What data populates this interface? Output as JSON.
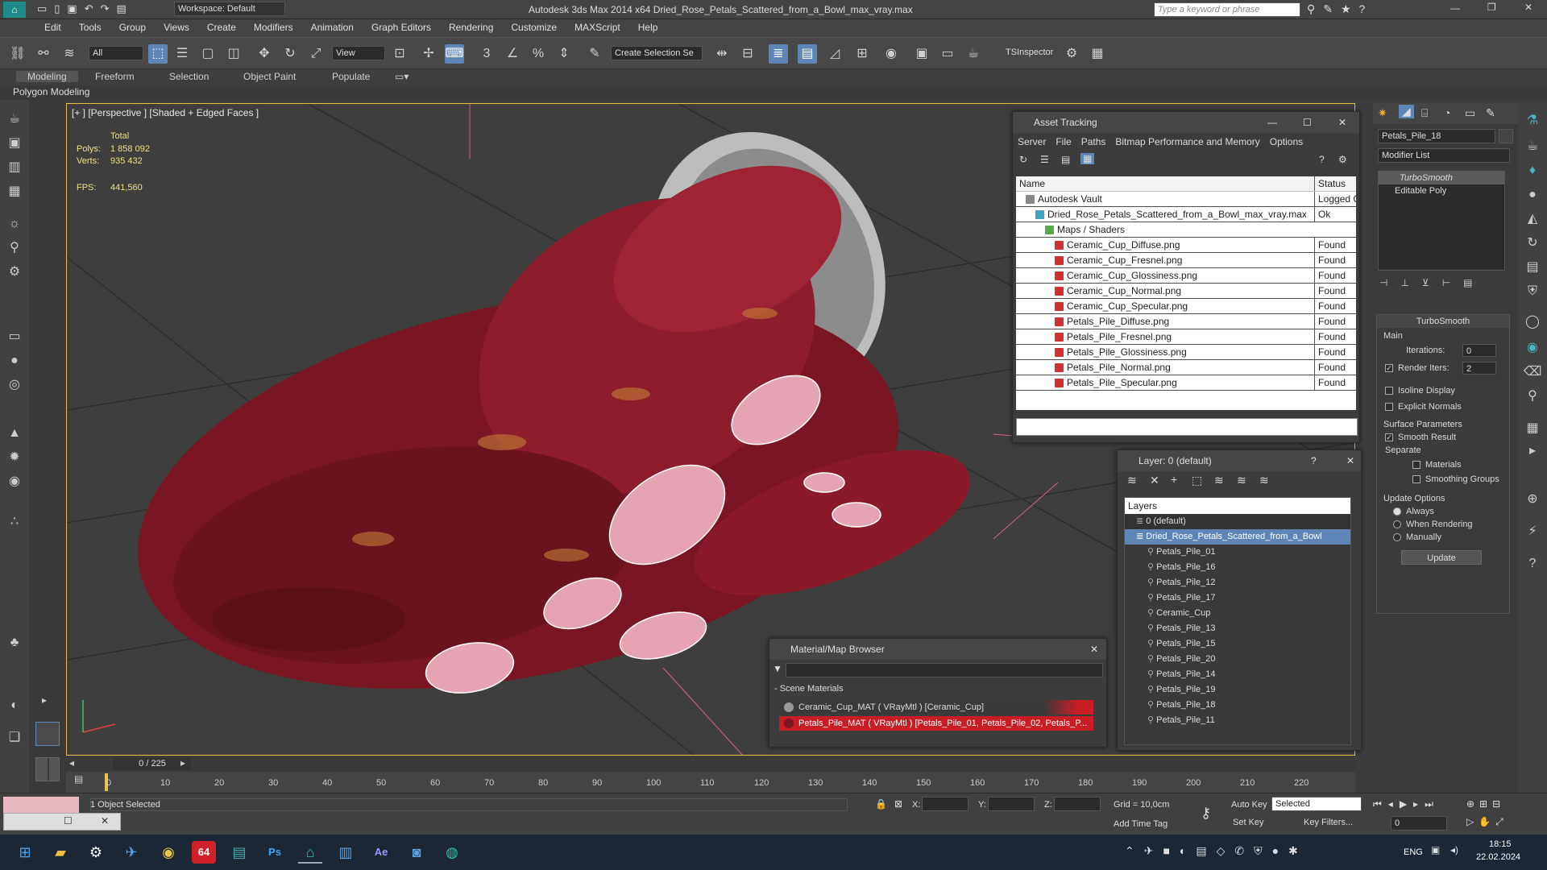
{
  "app": {
    "title": "Autodesk 3ds Max  2014 x64    Dried_Rose_Petals_Scattered_from_a_Bowl_max_vray.max",
    "workspace": "Workspace: Default",
    "search_placeholder": "Type a keyword or phrase"
  },
  "menu": [
    "Edit",
    "Tools",
    "Group",
    "Views",
    "Create",
    "Modifiers",
    "Animation",
    "Graph Editors",
    "Rendering",
    "Customize",
    "MAXScript",
    "Help"
  ],
  "toolbar": {
    "filter_value": "All",
    "view_value": "View",
    "selection_set": "Create Selection Se",
    "ts_inspector": "TSInspector"
  },
  "ribbon": {
    "tabs": [
      "Modeling",
      "Freeform",
      "Selection",
      "Object Paint",
      "Populate"
    ],
    "active": "Modeling",
    "subtab": "Polygon Modeling"
  },
  "viewport": {
    "label": "[+ ] [Perspective ] [Shaded + Edged Faces ]",
    "stats": {
      "total_label": "Total",
      "polys_label": "Polys:",
      "polys": "1 858 092",
      "verts_label": "Verts:",
      "verts": "935 432",
      "fps_label": "FPS:",
      "fps": "441,560"
    }
  },
  "asset_tracking": {
    "title": "Asset Tracking",
    "menu": [
      "Server",
      "File",
      "Paths",
      "Bitmap Performance and Memory",
      "Options"
    ],
    "col_name": "Name",
    "col_status": "Status",
    "rows": [
      {
        "name": "Autodesk Vault",
        "status": "Logged O",
        "indent": 1,
        "icon": "vault-icon"
      },
      {
        "name": "Dried_Rose_Petals_Scattered_from_a_Bowl_max_vray.max",
        "status": "Ok",
        "indent": 2,
        "icon": "max-file-icon"
      },
      {
        "name": "Maps / Shaders",
        "status": "",
        "indent": 3,
        "icon": "folder-icon"
      },
      {
        "name": "Ceramic_Cup_Diffuse.png",
        "status": "Found",
        "indent": 4,
        "icon": "png-icon"
      },
      {
        "name": "Ceramic_Cup_Fresnel.png",
        "status": "Found",
        "indent": 4,
        "icon": "png-icon"
      },
      {
        "name": "Ceramic_Cup_Glossiness.png",
        "status": "Found",
        "indent": 4,
        "icon": "png-icon"
      },
      {
        "name": "Ceramic_Cup_Normal.png",
        "status": "Found",
        "indent": 4,
        "icon": "png-icon"
      },
      {
        "name": "Ceramic_Cup_Specular.png",
        "status": "Found",
        "indent": 4,
        "icon": "png-icon"
      },
      {
        "name": "Petals_Pile_Diffuse.png",
        "status": "Found",
        "indent": 4,
        "icon": "png-icon"
      },
      {
        "name": "Petals_Pile_Fresnel.png",
        "status": "Found",
        "indent": 4,
        "icon": "png-icon"
      },
      {
        "name": "Petals_Pile_Glossiness.png",
        "status": "Found",
        "indent": 4,
        "icon": "png-icon"
      },
      {
        "name": "Petals_Pile_Normal.png",
        "status": "Found",
        "indent": 4,
        "icon": "png-icon"
      },
      {
        "name": "Petals_Pile_Specular.png",
        "status": "Found",
        "indent": 4,
        "icon": "png-icon"
      }
    ]
  },
  "layer_manager": {
    "title": "Layer: 0 (default)",
    "header": "Layers",
    "rows": [
      {
        "name": "0 (default)",
        "indent": 1,
        "selected": false
      },
      {
        "name": "Dried_Rose_Petals_Scattered_from_a_Bowl",
        "indent": 1,
        "selected": true
      },
      {
        "name": "Petals_Pile_01",
        "indent": 2,
        "selected": false
      },
      {
        "name": "Petals_Pile_16",
        "indent": 2,
        "selected": false
      },
      {
        "name": "Petals_Pile_12",
        "indent": 2,
        "selected": false
      },
      {
        "name": "Petals_Pile_17",
        "indent": 2,
        "selected": false
      },
      {
        "name": "Ceramic_Cup",
        "indent": 2,
        "selected": false
      },
      {
        "name": "Petals_Pile_13",
        "indent": 2,
        "selected": false
      },
      {
        "name": "Petals_Pile_15",
        "indent": 2,
        "selected": false
      },
      {
        "name": "Petals_Pile_20",
        "indent": 2,
        "selected": false
      },
      {
        "name": "Petals_Pile_14",
        "indent": 2,
        "selected": false
      },
      {
        "name": "Petals_Pile_19",
        "indent": 2,
        "selected": false
      },
      {
        "name": "Petals_Pile_18",
        "indent": 2,
        "selected": false
      },
      {
        "name": "Petals_Pile_11",
        "indent": 2,
        "selected": false
      }
    ]
  },
  "material_browser": {
    "title": "Material/Map Browser",
    "section": "- Scene Materials",
    "items": [
      "Ceramic_Cup_MAT  ( VRayMtl )  [Ceramic_Cup]",
      "Petals_Pile_MAT  ( VRayMtl )  [Petals_Pile_01, Petals_Pile_02, Petals_P..."
    ]
  },
  "command_panel": {
    "object_name": "Petals_Pile_18",
    "modifier_list": "Modifier List",
    "stack": [
      "TurboSmooth",
      "Editable Poly"
    ],
    "rollout_title": "TurboSmooth",
    "main": "Main",
    "iterations_label": "Iterations:",
    "iterations": "0",
    "render_iters_label": "Render Iters:",
    "render_iters": "2",
    "isoline": "Isoline Display",
    "explicit_normals": "Explicit Normals",
    "surface_params": "Surface Parameters",
    "smooth_result": "Smooth Result",
    "separate": "Separate",
    "materials": "Materials",
    "smoothing_groups": "Smoothing Groups",
    "update_options": "Update Options",
    "always": "Always",
    "when_rendering": "When Rendering",
    "manually": "Manually",
    "update_button": "Update"
  },
  "timeline": {
    "frame": "0 / 225",
    "ticks": [
      "0",
      "10",
      "20",
      "30",
      "40",
      "50",
      "60",
      "70",
      "80",
      "90",
      "100",
      "110",
      "120",
      "130",
      "140",
      "150",
      "160",
      "170",
      "180",
      "190",
      "200",
      "210",
      "220"
    ]
  },
  "status": {
    "selected": "1 Object Selected",
    "x_label": "X:",
    "y_label": "Y:",
    "z_label": "Z:",
    "grid": "Grid = 10,0cm",
    "auto_key": "Auto Key",
    "set_key": "Set Key",
    "key_mode": "Selected",
    "key_filters": "Key Filters...",
    "add_time_tag": "Add Time Tag",
    "frame_field": "0"
  },
  "taskbar": {
    "lang": "ENG",
    "time": "18:15",
    "date": "22.02.2024",
    "badge": "64"
  },
  "colors": {
    "accent": "#5d86b6",
    "viewport_border": "#e8c24b",
    "petal_red": "#9b1d2a",
    "stats_text": "#f0e084"
  }
}
